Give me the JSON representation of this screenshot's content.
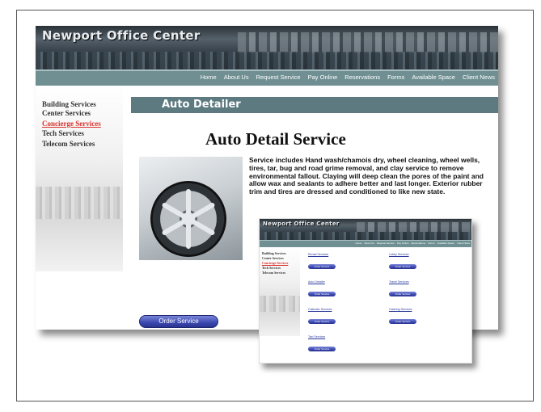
{
  "main": {
    "site_title": "Newport Office Center",
    "nav": [
      "Home",
      "About Us",
      "Request Service",
      "Pay Online",
      "Reservations",
      "Forms",
      "Available Space",
      "Client News"
    ],
    "sidebar": [
      "Building Services",
      "Center Services",
      "Concierge Services",
      "Tech Services",
      "Telecom Services"
    ],
    "sidebar_active": "Concierge Services",
    "section_title": "Auto Detailer",
    "heading": "Auto Detail Service",
    "description": "Service includes Hand wash/chamois dry, wheel cleaning, wheel wells, tires, tar, bug and road grime removal, and clay service to remove environmental fallout. Claying will deep clean the pores of the paint and allow wax and sealants to adhere better and last longer. Exterior rubber trim and tires are dressed and conditioned to like new state.",
    "order_button": "Order Service"
  },
  "inset": {
    "site_title": "Newport Office Center",
    "nav": [
      "Home",
      "About Us",
      "Request Service",
      "Pay Online",
      "Reservations",
      "Forms",
      "Available Space",
      "Client News"
    ],
    "sidebar": [
      "Building Services",
      "Center Services",
      "Concierge Services",
      "Tech Services",
      "Telecom Services"
    ],
    "left_items": [
      {
        "category": "Rental Services",
        "button": "Order Service"
      },
      {
        "category": "Auto Detailer",
        "button": "Order Service"
      },
      {
        "category": "Calendar Services",
        "button": "Order Service"
      },
      {
        "category": "Taxi Services",
        "button": "Order Service"
      }
    ],
    "right_items": [
      {
        "category": "Lobby Services",
        "button": "Order Service"
      },
      {
        "category": "Travel Services",
        "button": "Order Service"
      },
      {
        "category": "Catering Services",
        "button": "Order Service"
      }
    ]
  },
  "colors": {
    "nav_bar": "#6f8f92",
    "section_bar": "#5c7a80",
    "active_link": "#d9302c",
    "button": "#3b48b0"
  }
}
